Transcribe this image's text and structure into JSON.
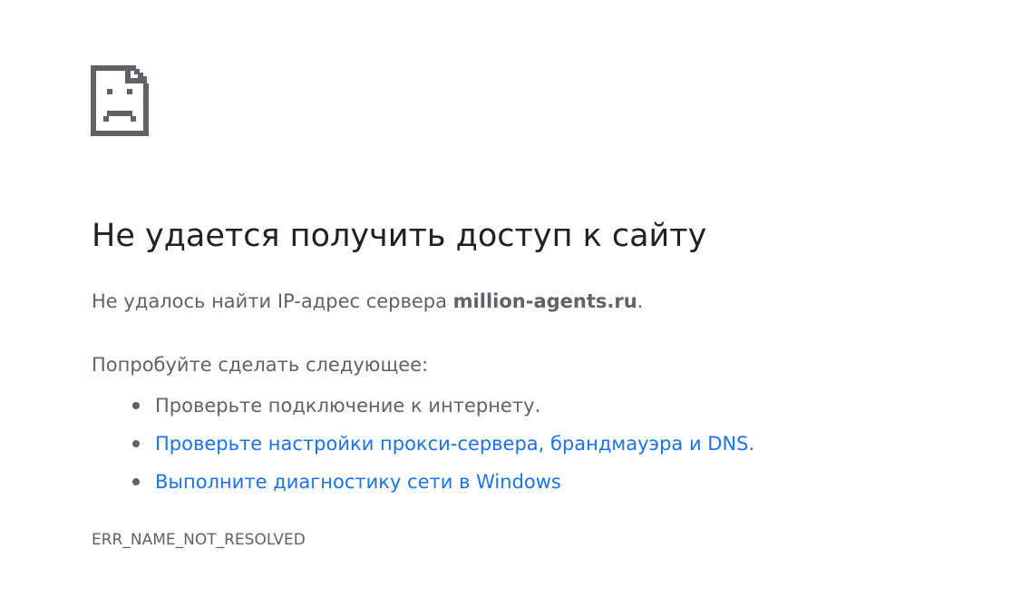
{
  "error_icon": "sad-page-icon",
  "title": "Не удается получить доступ к сайту",
  "summary": {
    "prefix": "Не удалось найти IP-адрес сервера ",
    "host": "million-agents.ru",
    "suffix": "."
  },
  "suggestions": {
    "heading": "Попробуйте сделать следующее:",
    "items": [
      {
        "text": "Проверьте подключение к интернету.",
        "link": false
      },
      {
        "text": "Проверьте настройки прокси-сервера, брандмауэра и DNS",
        "suffix": ".",
        "link": true
      },
      {
        "text": "Выполните диагностику сети в Windows",
        "link": true
      }
    ]
  },
  "error_code": "ERR_NAME_NOT_RESOLVED",
  "colors": {
    "title": "#202124",
    "body_text": "#5f6368",
    "link": "#1a73e8",
    "icon": "#5f6368"
  }
}
